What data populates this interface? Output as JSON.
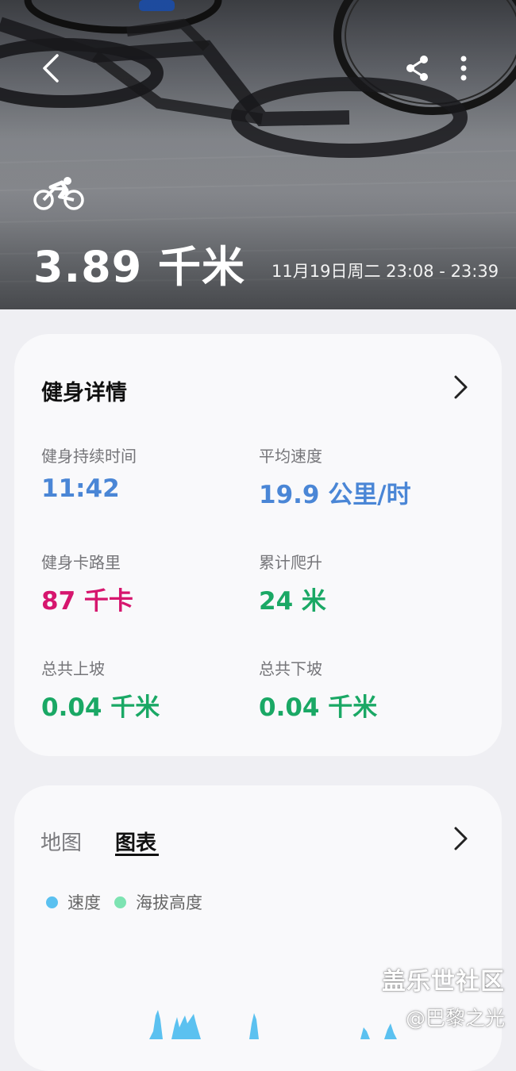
{
  "header": {
    "distance": "3.89 千米",
    "datetime": "11月19日周二 23:08 - 23:39"
  },
  "details": {
    "title": "健身详情",
    "stats": [
      {
        "label": "健身持续时间",
        "value": "11:42"
      },
      {
        "label": "平均速度",
        "value": "19.9 公里/时"
      },
      {
        "label": "健身卡路里",
        "value": "87 千卡"
      },
      {
        "label": "累计爬升",
        "value": "24 米"
      },
      {
        "label": "总共上坡",
        "value": "0.04 千米"
      },
      {
        "label": "总共下坡",
        "value": "0.04 千米"
      }
    ]
  },
  "chart_card": {
    "tabs": [
      "地图",
      "图表"
    ],
    "active_tab": "图表",
    "legend": [
      {
        "label": "速度",
        "color": "#5bc1f0"
      },
      {
        "label": "海拔高度",
        "color": "#7de3b2"
      }
    ]
  },
  "colors": {
    "duration": "#4a86d6",
    "speed": "#4a86d6",
    "calories": "#d6166e",
    "green_values": "#1aa865"
  },
  "watermark": {
    "line1": "盖乐世社区",
    "line2": "@巴黎之光"
  }
}
